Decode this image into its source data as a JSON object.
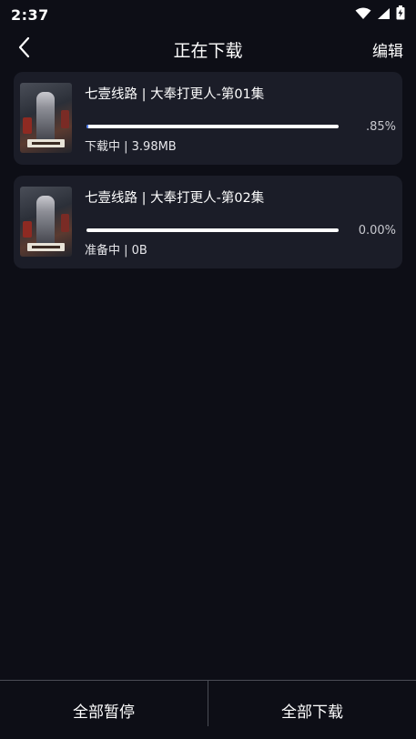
{
  "status_bar": {
    "time": "2:37",
    "icons": [
      "wifi-icon",
      "signal-icon",
      "battery-charging-icon"
    ]
  },
  "header": {
    "back_icon": "chevron-left-icon",
    "title": "正在下载",
    "edit_label": "编辑"
  },
  "downloads": [
    {
      "title": "七壹线路 | 大奉打更人-第01集",
      "percent_text": ".85%",
      "progress": 0.0085,
      "status": "下载中 | 3.98MB"
    },
    {
      "title": "七壹线路 | 大奉打更人-第02集",
      "percent_text": "0.00%",
      "progress": 0.0,
      "status": "准备中 | 0B"
    }
  ],
  "bottom_bar": {
    "pause_all_label": "全部暂停",
    "download_all_label": "全部下载"
  },
  "colors": {
    "background": "#0d0e16",
    "card": "#1b1d28",
    "progress_track": "#ffffff",
    "progress_fill": "#4a7cff"
  }
}
